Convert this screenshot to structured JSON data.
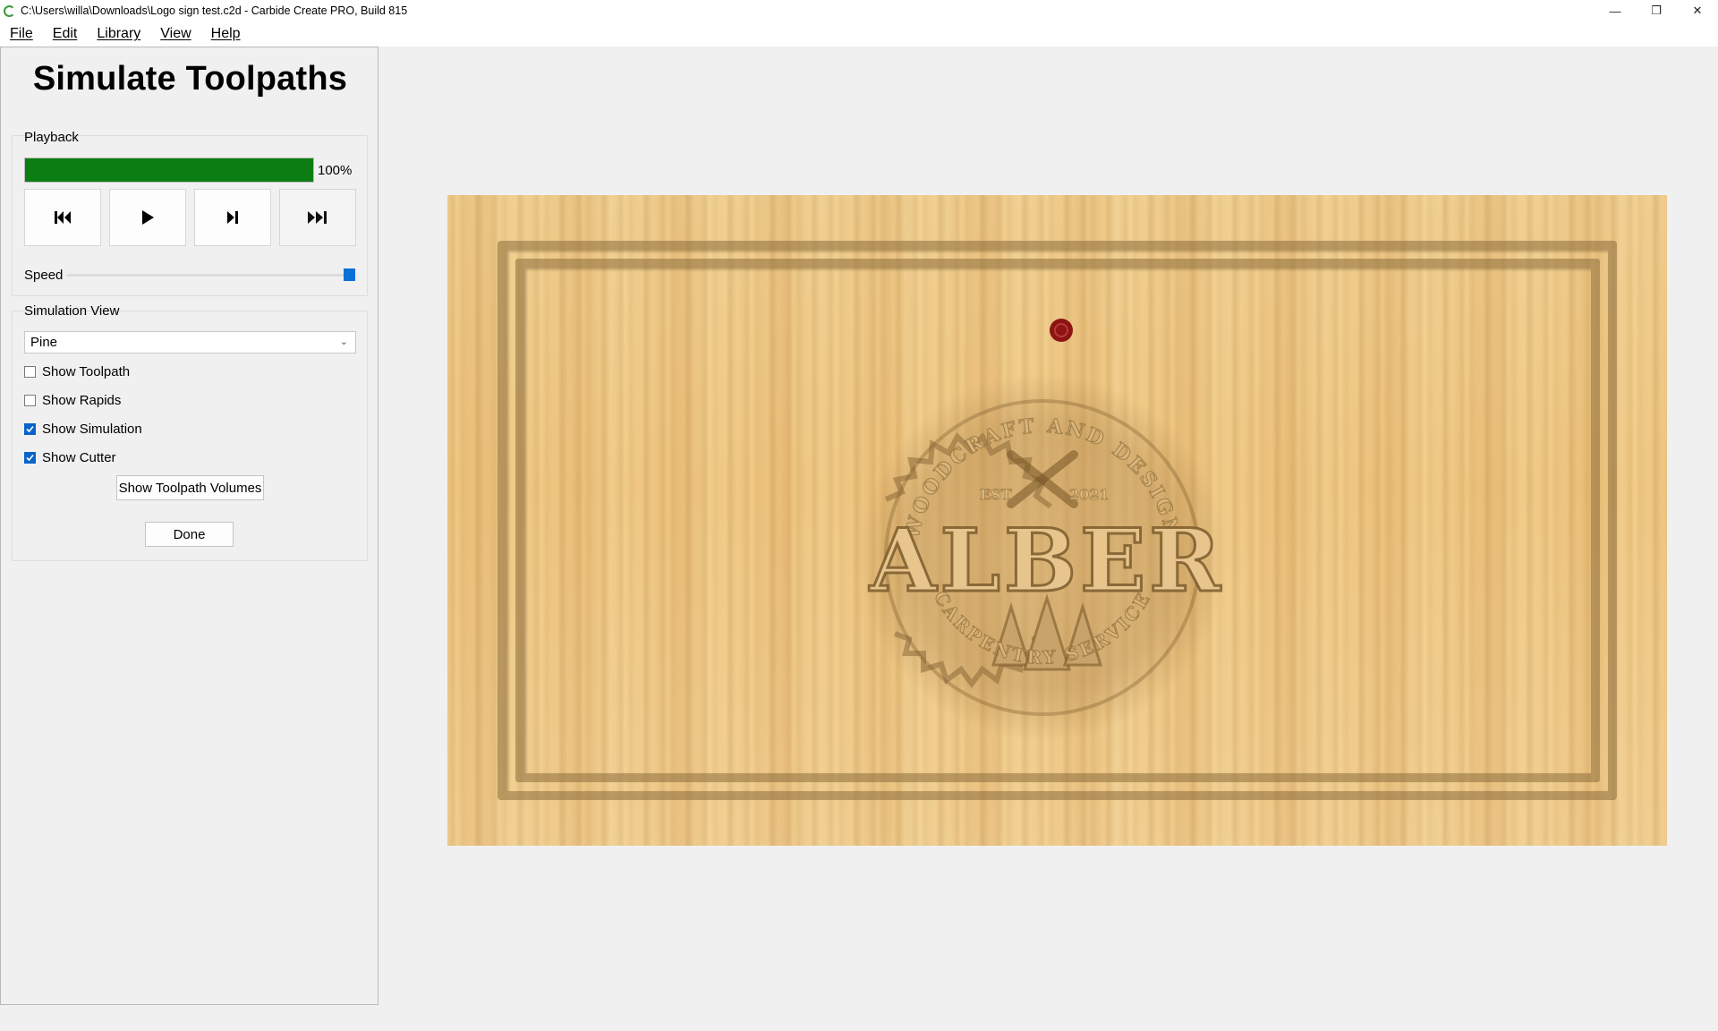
{
  "window": {
    "title": "C:\\Users\\willa\\Downloads\\Logo sign test.c2d - Carbide Create PRO, Build 815",
    "controls": {
      "minimize": "—",
      "restore": "❐",
      "close": "✕"
    }
  },
  "menu": {
    "items": [
      {
        "label": "File"
      },
      {
        "label": "Edit"
      },
      {
        "label": "Library"
      },
      {
        "label": "View"
      },
      {
        "label": "Help"
      }
    ]
  },
  "panel": {
    "title": "Simulate Toolpaths",
    "playback": {
      "label": "Playback",
      "progress_percent": 100,
      "progress_text": "100%",
      "buttons": [
        {
          "name": "rewind-to-start",
          "icon": "skip-start-icon",
          "enabled": true
        },
        {
          "name": "play",
          "icon": "play-icon",
          "enabled": true
        },
        {
          "name": "step-forward",
          "icon": "step-forward-icon",
          "enabled": true
        },
        {
          "name": "skip-to-end",
          "icon": "skip-end-icon",
          "enabled": false
        }
      ],
      "speed_label": "Speed",
      "speed_level": 1.0
    },
    "simulation_view": {
      "label": "Simulation View",
      "material": "Pine",
      "options": [
        {
          "label": "Show Toolpath",
          "checked": false
        },
        {
          "label": "Show Rapids",
          "checked": false
        },
        {
          "label": "Show Simulation",
          "checked": true
        },
        {
          "label": "Show Cutter",
          "checked": true
        }
      ],
      "volumes_button": "Show Toolpath Volumes"
    },
    "done_button": "Done"
  },
  "canvas": {
    "logo_texts": {
      "arc_top": "WOODCRAFT AND DESIGN",
      "est": "EST",
      "year": "2021",
      "name": "ALBER",
      "arc_bottom": "CARPENTRY SERVICE"
    }
  },
  "colors": {
    "progress": "#0c7d12",
    "accent": "#0a6fd6",
    "wood": "#eecb8c",
    "cutter": "#8e1414"
  }
}
